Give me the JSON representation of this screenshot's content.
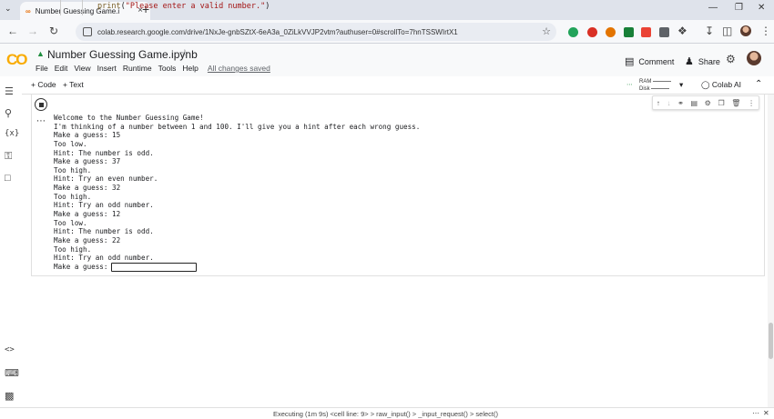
{
  "browser": {
    "tab_title": "Number Guessing Game.ipynb",
    "url": "colab.research.google.com/drive/1NxJe-gnbSZtX-6eA3a_0ZiLkVVJP2vtm?authuser=0#scrollTo=7hnTSSWIrtX1"
  },
  "colab": {
    "logo": "CO",
    "title": "Number Guessing Game.ipynb",
    "menu": [
      "File",
      "Edit",
      "View",
      "Insert",
      "Runtime",
      "Tools",
      "Help"
    ],
    "saved_status": "All changes saved",
    "comment_label": "Comment",
    "share_label": "Share"
  },
  "toolbar": {
    "code_label": "Code",
    "text_label": "Text",
    "ram_label": "RAM",
    "disk_label": "Disk",
    "colab_ai_label": "Colab AI"
  },
  "cell": {
    "code_kw": "print",
    "code_open": "(",
    "code_str": "\"Please enter a valid number.\"",
    "code_close": ")",
    "output_lines": [
      "Welcome to the Number Guessing Game!",
      "I'm thinking of a number between 1 and 100. I'll give you a hint after each wrong guess.",
      "Make a guess: 15",
      "Too low.",
      "Hint: The number is odd.",
      "Make a guess: 37",
      "Too high.",
      "Hint: Try an even number.",
      "Make a guess: 32",
      "Too high.",
      "Hint: Try an odd number.",
      "Make a guess: 12",
      "Too low.",
      "Hint: The number is odd.",
      "Make a guess: 22",
      "Too high.",
      "Hint: Try an odd number."
    ],
    "prompt": "Make a guess:",
    "input_value": ""
  },
  "status": {
    "executing": "Executing (1m 9s) <cell line: 9> > raw_input() > _input_request() > select()"
  },
  "colors": {
    "accent_orange": "#e8710a",
    "accent_yellow": "#f9ab00",
    "string_red": "#a31515"
  }
}
